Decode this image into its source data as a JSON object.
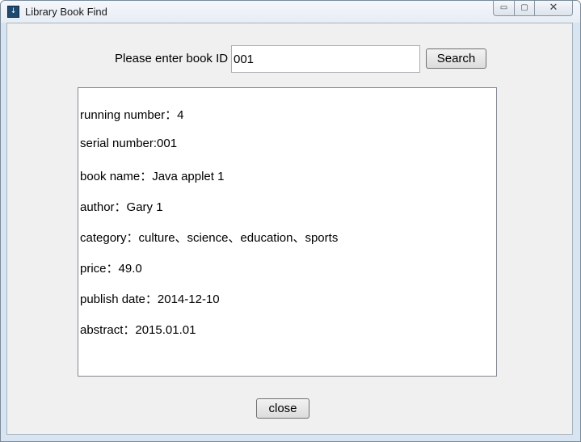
{
  "window": {
    "title": "Library Book Find",
    "app_icon": "window-app-icon",
    "controls": {
      "minimize": "minimize-icon",
      "maximize": "maximize-icon",
      "close": "close-icon"
    }
  },
  "search": {
    "label": "Please enter book ID",
    "value": "001",
    "button_label": "Search"
  },
  "result": {
    "lines": [
      "running number：4",
      "serial number:001",
      "book name：Java applet 1",
      "author：Gary 1",
      "category：culture、science、education、sports",
      "price：49.0",
      "publish date：2014-12-10",
      "abstract：2015.01.01"
    ]
  },
  "footer": {
    "close_label": "close"
  }
}
